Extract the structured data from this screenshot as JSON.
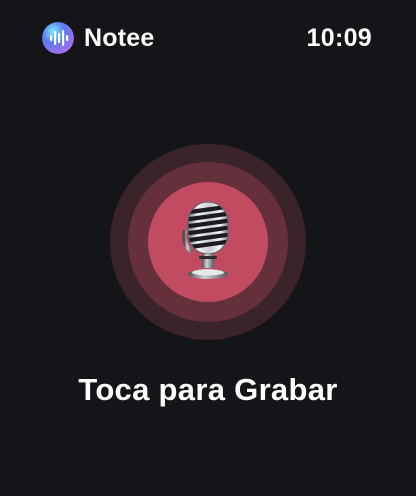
{
  "app": {
    "name": "Notee",
    "icon": "notee-app-icon"
  },
  "status_bar": {
    "time": "10:09"
  },
  "record": {
    "icon": "microphone-icon",
    "label": "Toca para Grabar"
  },
  "colors": {
    "background": "#141518",
    "ring_outer": "#3a2329",
    "ring_middle": "#652f3c",
    "ring_inner": "#c14c61",
    "text": "#ffffff"
  }
}
